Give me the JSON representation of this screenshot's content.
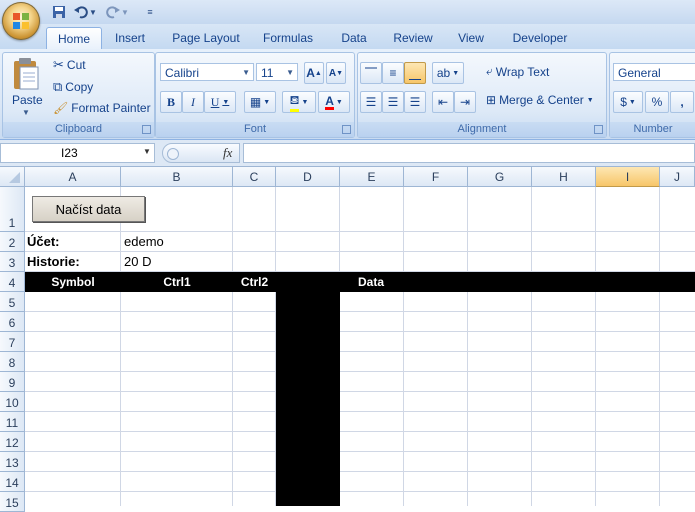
{
  "qat": {
    "save_icon": "save-icon",
    "undo_icon": "undo-icon",
    "redo_icon": "redo-icon"
  },
  "tabs": [
    "Home",
    "Insert",
    "Page Layout",
    "Formulas",
    "Data",
    "Review",
    "View",
    "Developer"
  ],
  "ribbon": {
    "clipboard": {
      "label": "Clipboard",
      "paste": "Paste",
      "cut": "Cut",
      "copy": "Copy",
      "format_painter": "Format Painter"
    },
    "font": {
      "label": "Font",
      "font_name": "Calibri",
      "font_size": "11",
      "bold": "B",
      "italic": "I",
      "underline": "U",
      "grow": "A",
      "shrink": "A"
    },
    "alignment": {
      "label": "Alignment",
      "wrap_text": "Wrap Text",
      "merge_center": "Merge & Center"
    },
    "number": {
      "label": "Number",
      "format": "General",
      "currency": "$",
      "percent": "%",
      "comma": ","
    }
  },
  "formula_bar": {
    "name_box": "I23",
    "fx": "fx",
    "formula": ""
  },
  "columns": [
    "A",
    "B",
    "C",
    "D",
    "E",
    "F",
    "G",
    "H",
    "I",
    "J"
  ],
  "selected_column": "I",
  "rows": [
    "1",
    "2",
    "3",
    "4",
    "5",
    "6",
    "7",
    "8",
    "9",
    "10",
    "11",
    "12",
    "13",
    "14",
    "15"
  ],
  "sheet": {
    "button_label": "Načíst data",
    "account_label": "Účet:",
    "account_value": "edemo",
    "history_label": "Historie:",
    "history_value": "20 D",
    "header_symbol": "Symbol",
    "header_ctrl1": "Ctrl1",
    "header_ctrl2": "Ctrl2",
    "header_data": "Data"
  },
  "colors": {
    "header_fill": "#000000",
    "header_text": "#ffffff",
    "selected_header": "#f7c669"
  }
}
